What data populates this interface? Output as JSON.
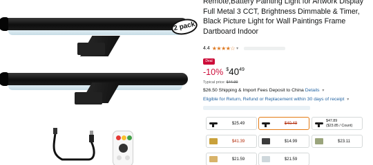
{
  "product": {
    "title": "Remote,Battery Painting Light for Artwork Display Full Metal 3 CCT, Brightness Dimmable & Timer, Black Picture Light for Wall Paintings Frame Dartboard Indoor",
    "pack_badge": "2 pack",
    "rating": "4.4",
    "stars": "★★★★☆",
    "deal_label": "Deal",
    "discount": "-10%",
    "price_symbol": "$",
    "price_whole": "40",
    "price_fraction": "49",
    "typical_label": "Typical price:",
    "typical_price": "$44.99",
    "shipping_text": "$26.50 Shipping & Import Fees Deposit to China",
    "shipping_details": "Details",
    "returns_text": "Eligible for Return, Refund or Replacement within 30 days of receipt"
  },
  "variations": [
    {
      "price": "$25.49",
      "selected": false,
      "red": false,
      "strike": false,
      "thumb": "bar",
      "thumb_color": "#1a1a1a"
    },
    {
      "price": "$40.49",
      "selected": true,
      "red": true,
      "strike": true,
      "thumb": "bar",
      "thumb_color": "#1a1a1a"
    },
    {
      "price_line1": "$47.89",
      "price_line2": "($23.85 / Count)",
      "selected": false,
      "thumb": "bar",
      "thumb_color": "#1a1a1a"
    },
    {
      "price": "$41.39",
      "selected": false,
      "red": true,
      "strike": false,
      "thumb": "art",
      "thumb_color": "#c9a13b"
    },
    {
      "price": "$14.99",
      "selected": false,
      "red": false,
      "strike": false,
      "thumb": "art",
      "thumb_color": "#3b3b3b"
    },
    {
      "price": "$23.11",
      "selected": false,
      "red": false,
      "strike": false,
      "thumb": "art",
      "thumb_color": "#9aa47c"
    },
    {
      "price": "$21.59",
      "selected": false,
      "red": false,
      "strike": false,
      "thumb": "art",
      "thumb_color": "#d8b36a"
    },
    {
      "price": "$21.59",
      "selected": false,
      "red": false,
      "strike": false,
      "thumb": "art",
      "thumb_color": "#cfd8dc"
    }
  ],
  "colors": {
    "accent": "#e47911",
    "deal": "#cc0c39",
    "link": "#2162a1",
    "stars": "#de7921"
  }
}
